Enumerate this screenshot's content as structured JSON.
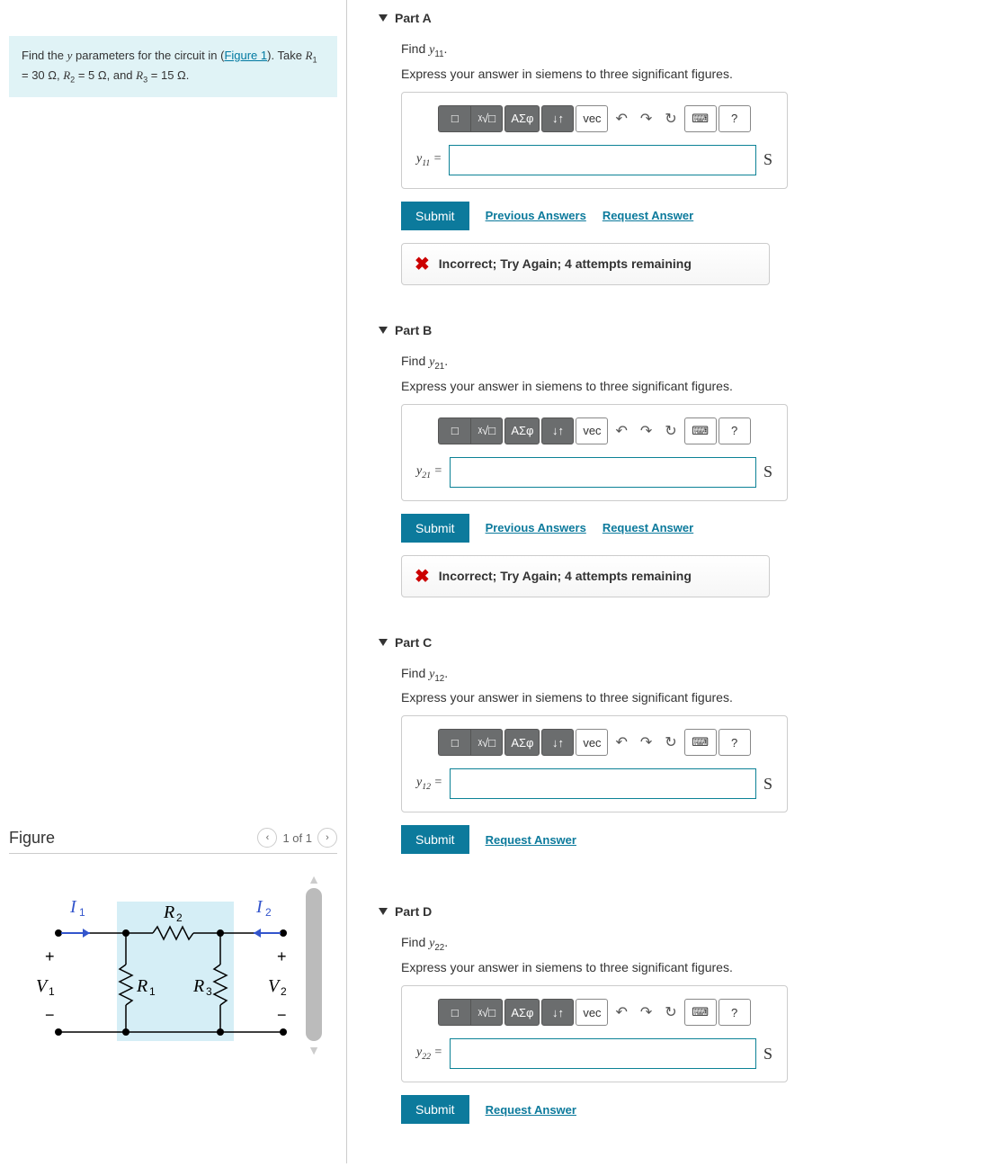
{
  "prompt": {
    "pre": "Find the ",
    "y": "y",
    "mid1": " parameters for the circuit in (",
    "link": "Figure 1",
    "mid2": "). Take ",
    "R1": "R",
    "R1s": "1",
    "R1v": " = 30 Ω, ",
    "R2": "R",
    "R2s": "2",
    "R2v": " = 5 Ω, and ",
    "R3": "R",
    "R3s": "3",
    "R3v": " = 15 Ω."
  },
  "figure": {
    "title": "Figure",
    "counter": "1 of 1",
    "labels": {
      "I1": "I",
      "I1s": "1",
      "I2": "I",
      "I2s": "2",
      "R2": "R",
      "R2s": "2",
      "R1": "R",
      "R1s": "1",
      "R3": "R",
      "R3s": "3",
      "V1": "V",
      "V1s": "1",
      "V2": "V",
      "V2s": "2",
      "plusL": "+",
      "minusL": "−",
      "plusR": "+",
      "minusR": "−"
    }
  },
  "toolbar": {
    "tmpl": "□",
    "sqrt": "ᵡ√□",
    "greek": "ΑΣφ",
    "arrows": "↓↑",
    "vec": "vec",
    "undo": "↶",
    "redo": "↷",
    "reset": "↻",
    "keyb": "⌨",
    "help": "?"
  },
  "common": {
    "instr2": "Express your answer in siemens to three significant figures.",
    "unit": "S",
    "submit": "Submit",
    "prev": "Previous Answers",
    "req": "Request Answer",
    "fb": "Incorrect; Try Again; 4 attempts remaining"
  },
  "parts": {
    "A": {
      "title": "Part A",
      "find_pre": "Find ",
      "find_y": "y",
      "find_sub": "11",
      "find_post": ".",
      "lhs_y": "y",
      "lhs_sub": "11",
      "lhs_eq": " ="
    },
    "B": {
      "title": "Part B",
      "find_pre": "Find ",
      "find_y": "y",
      "find_sub": "21",
      "find_post": ".",
      "lhs_y": "y",
      "lhs_sub": "21",
      "lhs_eq": " ="
    },
    "C": {
      "title": "Part C",
      "find_pre": "Find ",
      "find_y": "y",
      "find_sub": "12",
      "find_post": ".",
      "lhs_y": "y",
      "lhs_sub": "12",
      "lhs_eq": " ="
    },
    "D": {
      "title": "Part D",
      "find_pre": "Find ",
      "find_y": "y",
      "find_sub": "22",
      "find_post": ".",
      "lhs_y": "y",
      "lhs_sub": "22",
      "lhs_eq": " ="
    }
  }
}
